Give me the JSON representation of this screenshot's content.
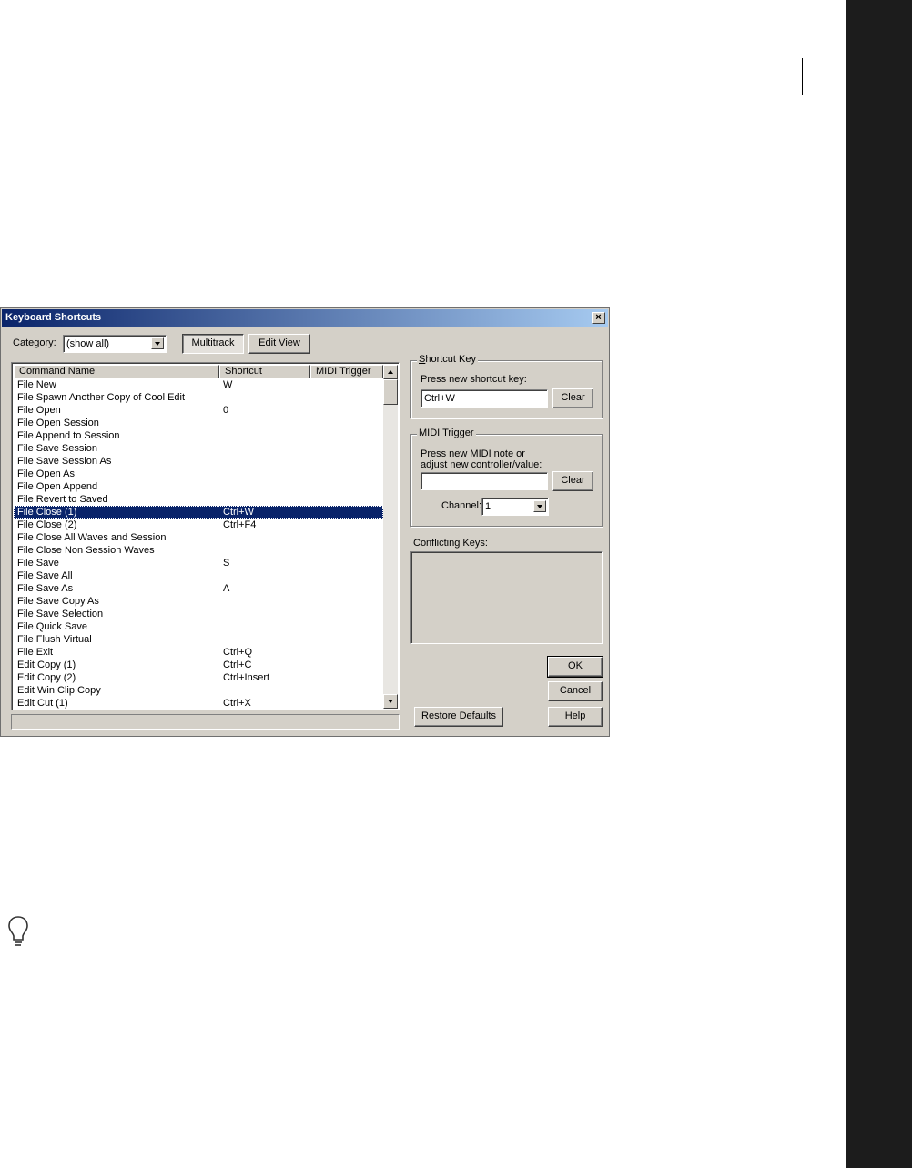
{
  "dialog": {
    "title": "Keyboard Shortcuts",
    "close_glyph": "×",
    "category": {
      "label_first": "C",
      "label_rest": "ategory:",
      "value": "(show all)"
    },
    "toggles": {
      "multitrack": "Multitrack",
      "edit_view": "Edit View"
    },
    "list": {
      "columns": [
        "Command Name",
        "Shortcut",
        "MIDI Trigger"
      ],
      "rows": [
        {
          "name": "File New",
          "shortcut": "W"
        },
        {
          "name": "File Spawn Another Copy of Cool Edit",
          "shortcut": ""
        },
        {
          "name": "File Open",
          "shortcut": "0"
        },
        {
          "name": "File Open Session",
          "shortcut": ""
        },
        {
          "name": "File Append to Session",
          "shortcut": ""
        },
        {
          "name": "File Save Session",
          "shortcut": ""
        },
        {
          "name": "File Save Session As",
          "shortcut": ""
        },
        {
          "name": "File Open As",
          "shortcut": ""
        },
        {
          "name": "File Open Append",
          "shortcut": ""
        },
        {
          "name": "File Revert to Saved",
          "shortcut": ""
        },
        {
          "name": "File Close (1)",
          "shortcut": "Ctrl+W"
        },
        {
          "name": "File Close (2)",
          "shortcut": "Ctrl+F4"
        },
        {
          "name": "File Close All Waves and Session",
          "shortcut": ""
        },
        {
          "name": "File Close Non Session Waves",
          "shortcut": ""
        },
        {
          "name": "File Save",
          "shortcut": "S"
        },
        {
          "name": "File Save All",
          "shortcut": ""
        },
        {
          "name": "File Save As",
          "shortcut": "A"
        },
        {
          "name": "File Save Copy As",
          "shortcut": ""
        },
        {
          "name": "File Save Selection",
          "shortcut": ""
        },
        {
          "name": "File Quick Save",
          "shortcut": ""
        },
        {
          "name": "File Flush Virtual",
          "shortcut": ""
        },
        {
          "name": "File Exit",
          "shortcut": "Ctrl+Q"
        },
        {
          "name": "Edit Copy (1)",
          "shortcut": "Ctrl+C"
        },
        {
          "name": "Edit Copy (2)",
          "shortcut": "Ctrl+Insert"
        },
        {
          "name": "Edit Win Clip Copy",
          "shortcut": ""
        },
        {
          "name": "Edit Cut (1)",
          "shortcut": "Ctrl+X"
        }
      ]
    },
    "shortcut_key": {
      "title_first": "S",
      "title_rest": "hortcut Key",
      "prompt": "Press new shortcut key:",
      "value": "Ctrl+W",
      "clear": "Clear"
    },
    "midi_trigger": {
      "title": "MIDI Trigger",
      "prompt_line1": "Press new MIDI note or",
      "prompt_line2": "adjust new controller/value:",
      "value": "",
      "clear": "Clear",
      "channel_label": "Channel:",
      "channel_value": "1"
    },
    "conflicting": {
      "label": "Conflicting Keys:"
    },
    "buttons": {
      "ok": "OK",
      "cancel": "Cancel",
      "help": "Help",
      "restore": "Restore Defaults"
    }
  }
}
